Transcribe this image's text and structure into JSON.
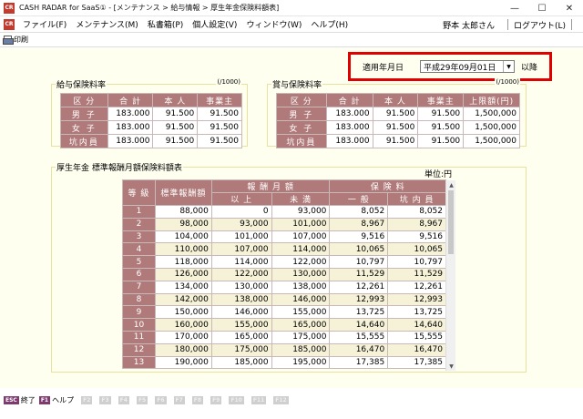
{
  "window": {
    "title": "CASH RADAR for SaaS① - [メンテナンス > 給与情報 > 厚生年金保険料額表]",
    "logo_text": "CR",
    "minimize": "—",
    "maximize": "☐",
    "close": "✕"
  },
  "menu": {
    "items": [
      "ファイル(F)",
      "メンテナンス(M)",
      "私書箱(P)",
      "個人設定(V)",
      "ウィンドウ(W)",
      "ヘルプ(H)"
    ],
    "user": "野本 太郎さん",
    "logout": "ログアウト(L)"
  },
  "toolbar": {
    "print_label": "印刷"
  },
  "date_filter": {
    "label": "適用年月日",
    "value": "平成29年09月01日",
    "suffix": "以降"
  },
  "salary_panel": {
    "title": "給与保険料率",
    "unit": "(/1000)",
    "headers": [
      "区 分",
      "合 計",
      "本 人",
      "事業主"
    ],
    "rows": [
      [
        "男 子",
        "183.000",
        "91.500",
        "91.500"
      ],
      [
        "女 子",
        "183.000",
        "91.500",
        "91.500"
      ],
      [
        "坑内員",
        "183.000",
        "91.500",
        "91.500"
      ]
    ]
  },
  "bonus_panel": {
    "title": "賞与保険料率",
    "unit": "(/1000)",
    "headers": [
      "区 分",
      "合 計",
      "本 人",
      "事業主",
      "上限額(円)"
    ],
    "rows": [
      [
        "男 子",
        "183.000",
        "91.500",
        "91.500",
        "1,500,000"
      ],
      [
        "女 子",
        "183.000",
        "91.500",
        "91.500",
        "1,500,000"
      ],
      [
        "坑内員",
        "183.000",
        "91.500",
        "91.500",
        "1,500,000"
      ]
    ]
  },
  "grade_table": {
    "title": "厚生年金 標準報酬月額保険料額表",
    "unit": "単位:円",
    "header_grade": "等 級",
    "header_standard": "標準報酬額",
    "header_range": "報 酬 月 額",
    "header_over": "以 上",
    "header_under": "未 満",
    "header_premium": "保 険 料",
    "header_general": "一 般",
    "header_miner": "坑 内 員",
    "rows": [
      [
        "1",
        "88,000",
        "0",
        "93,000",
        "8,052",
        "8,052"
      ],
      [
        "2",
        "98,000",
        "93,000",
        "101,000",
        "8,967",
        "8,967"
      ],
      [
        "3",
        "104,000",
        "101,000",
        "107,000",
        "9,516",
        "9,516"
      ],
      [
        "4",
        "110,000",
        "107,000",
        "114,000",
        "10,065",
        "10,065"
      ],
      [
        "5",
        "118,000",
        "114,000",
        "122,000",
        "10,797",
        "10,797"
      ],
      [
        "6",
        "126,000",
        "122,000",
        "130,000",
        "11,529",
        "11,529"
      ],
      [
        "7",
        "134,000",
        "130,000",
        "138,000",
        "12,261",
        "12,261"
      ],
      [
        "8",
        "142,000",
        "138,000",
        "146,000",
        "12,993",
        "12,993"
      ],
      [
        "9",
        "150,000",
        "146,000",
        "155,000",
        "13,725",
        "13,725"
      ],
      [
        "10",
        "160,000",
        "155,000",
        "165,000",
        "14,640",
        "14,640"
      ],
      [
        "11",
        "170,000",
        "165,000",
        "175,000",
        "15,555",
        "15,555"
      ],
      [
        "12",
        "180,000",
        "175,000",
        "185,000",
        "16,470",
        "16,470"
      ],
      [
        "13",
        "190,000",
        "185,000",
        "195,000",
        "17,385",
        "17,385"
      ]
    ]
  },
  "function_keys": [
    {
      "key": "ESC",
      "label": "終了",
      "enabled": true
    },
    {
      "key": "F1",
      "label": "ヘルプ",
      "enabled": true
    },
    {
      "key": "F2",
      "label": "",
      "enabled": false
    },
    {
      "key": "F3",
      "label": "",
      "enabled": false
    },
    {
      "key": "F4",
      "label": "",
      "enabled": false
    },
    {
      "key": "F5",
      "label": "",
      "enabled": false
    },
    {
      "key": "F6",
      "label": "",
      "enabled": false
    },
    {
      "key": "F7",
      "label": "",
      "enabled": false
    },
    {
      "key": "F8",
      "label": "",
      "enabled": false
    },
    {
      "key": "F9",
      "label": "",
      "enabled": false
    },
    {
      "key": "F10",
      "label": "",
      "enabled": false
    },
    {
      "key": "F11",
      "label": "",
      "enabled": false
    },
    {
      "key": "F12",
      "label": "",
      "enabled": false
    }
  ]
}
